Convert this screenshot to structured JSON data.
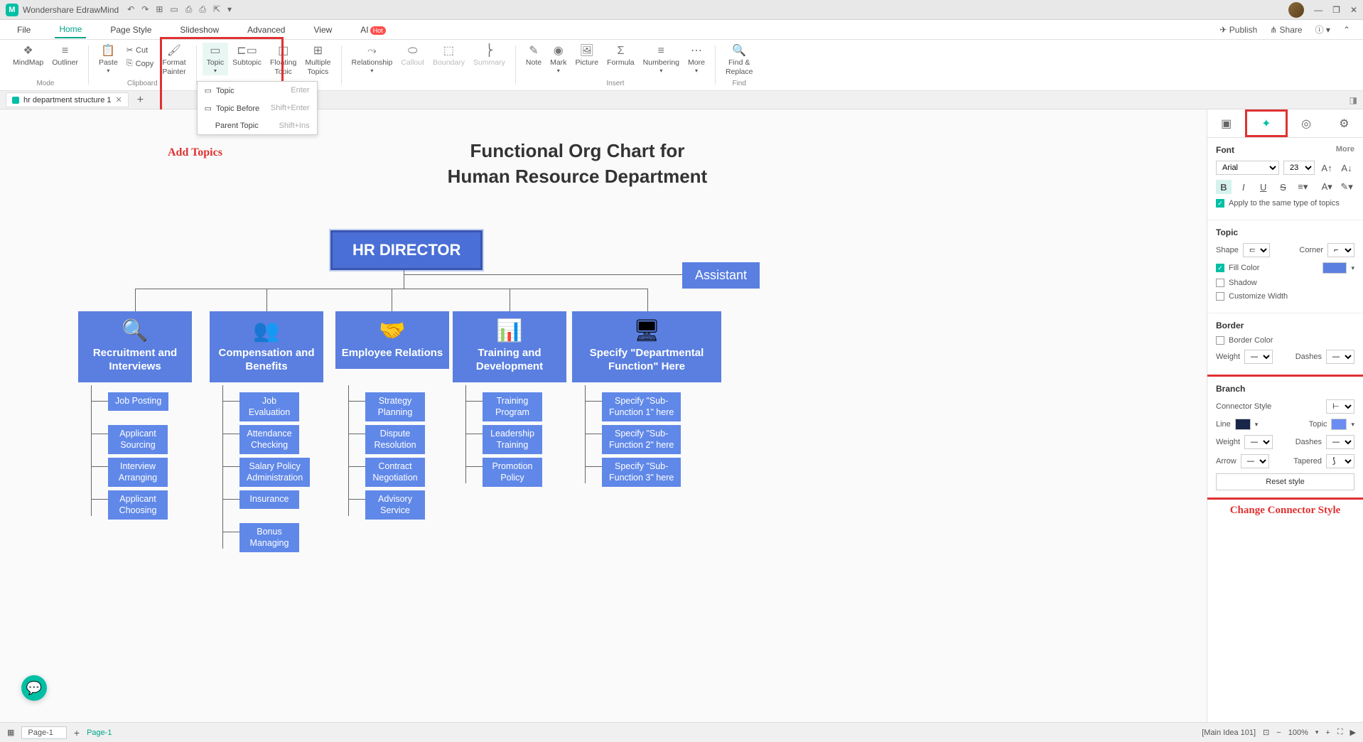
{
  "app": {
    "title": "Wondershare EdrawMind"
  },
  "window_controls": {
    "min": "—",
    "max": "❐",
    "close": "✕"
  },
  "menubar": {
    "items": [
      "File",
      "Home",
      "Page Style",
      "Slideshow",
      "Advanced",
      "View"
    ],
    "ai": "AI",
    "ai_badge": "Hot",
    "publish": "Publish",
    "share": "Share"
  },
  "ribbon": {
    "mode": {
      "mindmap": "MindMap",
      "outliner": "Outliner",
      "label": "Mode"
    },
    "clipboard": {
      "paste": "Paste",
      "cut": "Cut",
      "copy": "Copy",
      "format_painter": "Format\nPainter",
      "label": "Clipboard"
    },
    "topic_group": {
      "topic": "Topic",
      "subtopic": "Subtopic",
      "floating": "Floating\nTopic",
      "multiple": "Multiple\nTopics"
    },
    "relationship": "Relationship",
    "callout": "Callout",
    "boundary": "Boundary",
    "summary": "Summary",
    "insert": {
      "note": "Note",
      "mark": "Mark",
      "picture": "Picture",
      "formula": "Formula",
      "numbering": "Numbering",
      "more": "More",
      "label": "Insert"
    },
    "find": {
      "label": "Find &\nReplace",
      "group": "Find"
    }
  },
  "topic_dropdown": {
    "topic": {
      "label": "Topic",
      "shortcut": "Enter"
    },
    "before": {
      "label": "Topic Before",
      "shortcut": "Shift+Enter"
    },
    "parent": {
      "label": "Parent Topic",
      "shortcut": "Shift+Ins"
    }
  },
  "annotations": {
    "add_topics": "Add Topics",
    "connector": "Change Connector Style"
  },
  "tabs": {
    "doc": "hr department structure 1"
  },
  "chart": {
    "title_line1": "Functional Org Chart for",
    "title_line2": "Human Resource Department",
    "root": "HR DIRECTOR",
    "assistant": "Assistant",
    "depts": [
      {
        "label": "Recruitment and Interviews",
        "subs": [
          "Job Posting",
          "Applicant\nSourcing",
          "Interview\nArranging",
          "Applicant\nChoosing"
        ]
      },
      {
        "label": "Compensation and Benefits",
        "subs": [
          "Job\nEvaluation",
          "Attendance\nChecking",
          "Salary Policy\nAdministration",
          "Insurance",
          "Bonus\nManaging"
        ]
      },
      {
        "label": "Employee Relations",
        "subs": [
          "Strategy\nPlanning",
          "Dispute\nResolution",
          "Contract\nNegotiation",
          "Advisory\nService"
        ]
      },
      {
        "label": "Training and Development",
        "subs": [
          "Training\nProgram",
          "Leadership\nTraining",
          "Promotion\nPolicy"
        ]
      },
      {
        "label": "Specify \"Departmental Function\" Here",
        "subs": [
          "Specify \"Sub-\nFunction 1\" here",
          "Specify \"Sub-\nFunction 2\" here",
          "Specify \"Sub-\nFunction 3\" here"
        ]
      }
    ]
  },
  "right_panel": {
    "font_header": "Font",
    "more": "More",
    "font_family": "Arial",
    "font_size": "23",
    "apply_same": "Apply to the same type of topics",
    "topic_header": "Topic",
    "shape": "Shape",
    "corner": "Corner",
    "fill_color": "Fill Color",
    "shadow": "Shadow",
    "customize_width": "Customize Width",
    "border_header": "Border",
    "border_color": "Border Color",
    "weight": "Weight",
    "dashes": "Dashes",
    "branch_header": "Branch",
    "connector_style": "Connector Style",
    "line": "Line",
    "topic_color": "Topic",
    "arrow": "Arrow",
    "tapered": "Tapered",
    "reset": "Reset style"
  },
  "statusbar": {
    "page_sel": "Page-1",
    "page_name": "Page-1",
    "main_idea": "[Main Idea 101]",
    "zoom": "100%"
  },
  "colors": {
    "fill": "#5a7fe0",
    "line": "#18264a",
    "topic_color": "#6b8cf0"
  }
}
